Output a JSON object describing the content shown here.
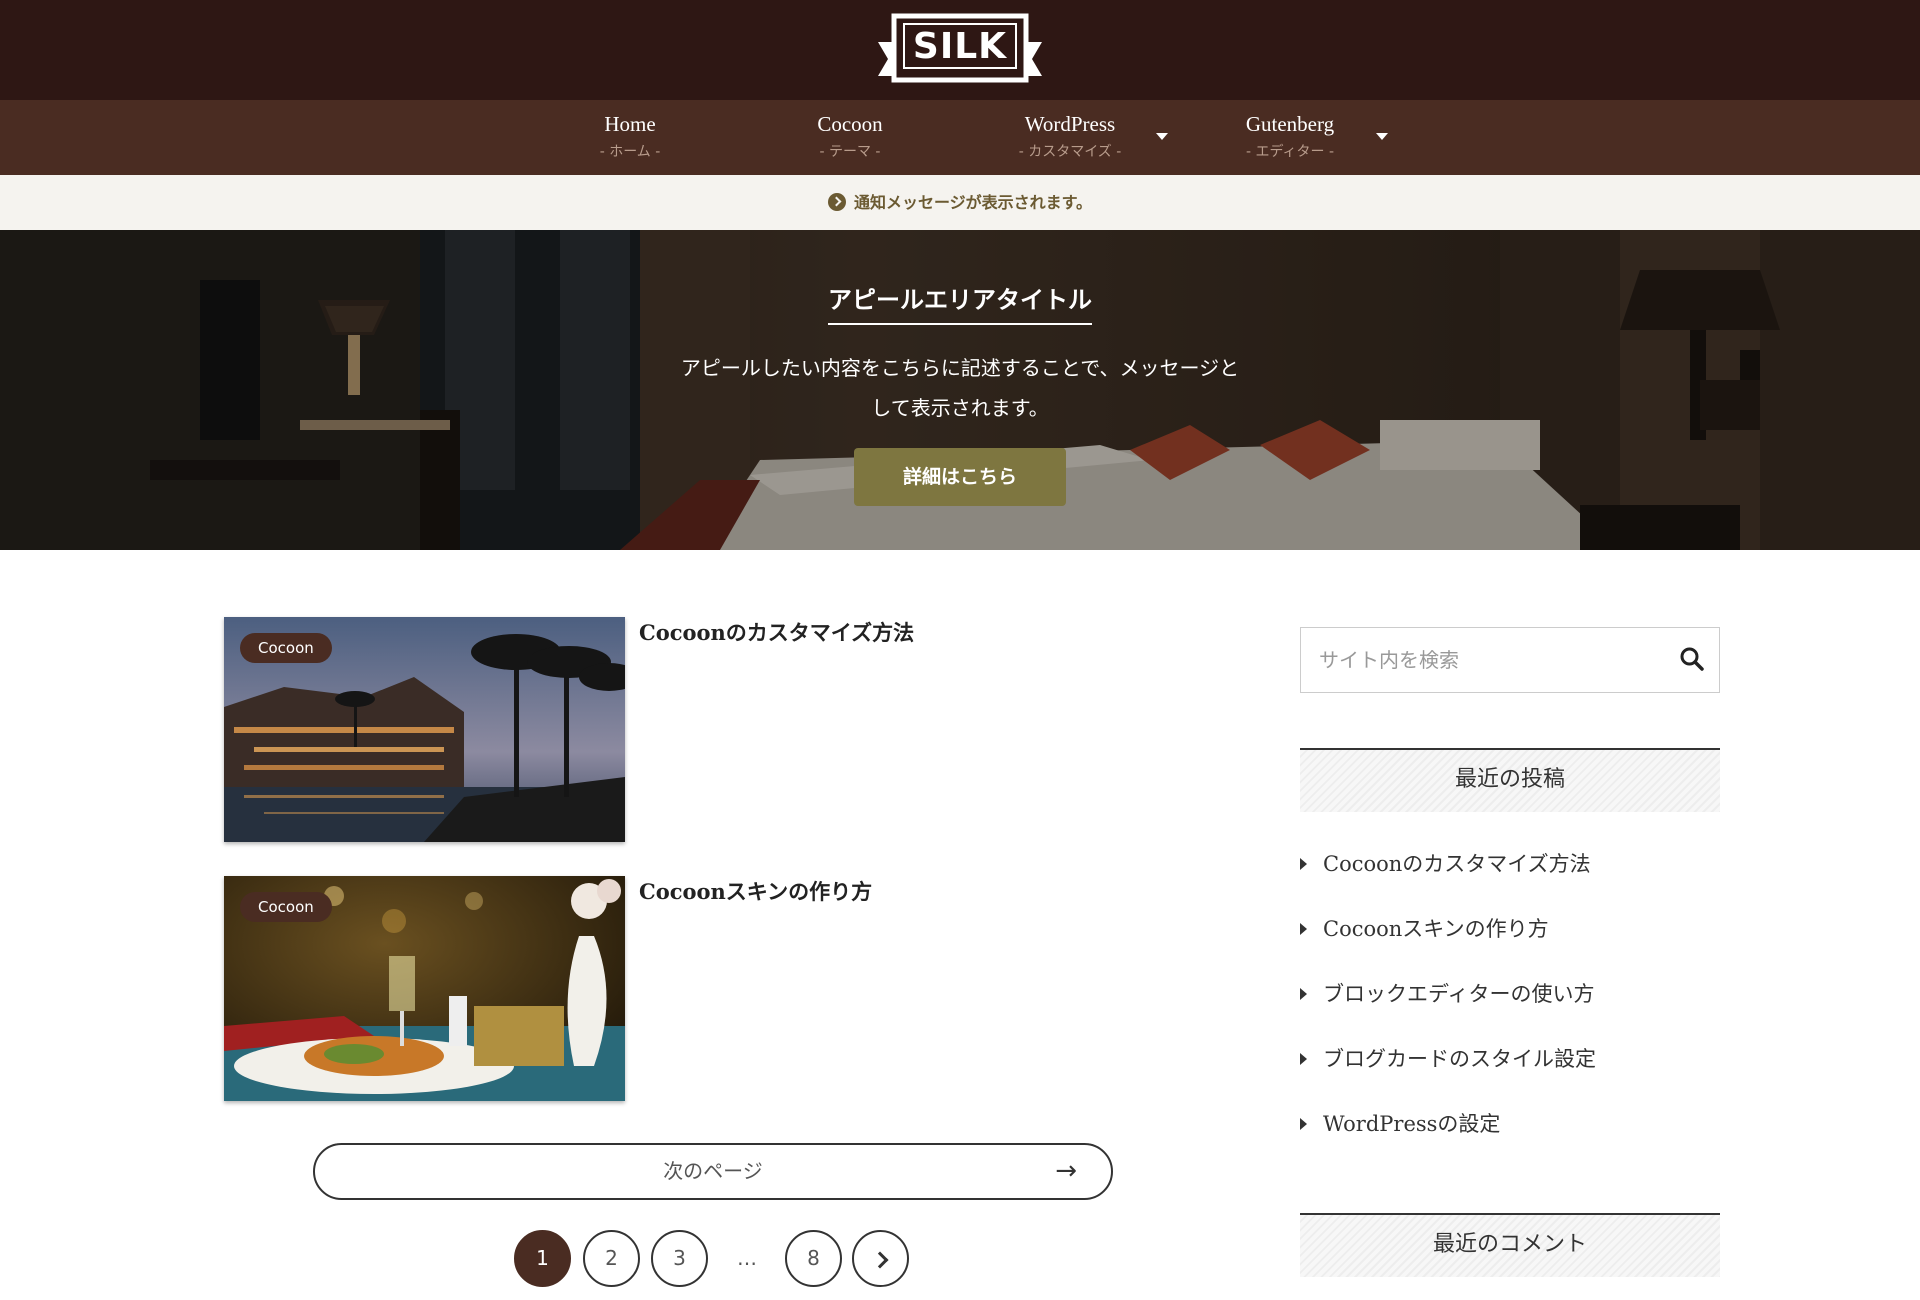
{
  "header": {
    "logo_text": "SILK"
  },
  "nav": {
    "items": [
      {
        "label": "Home",
        "sub": "- ホーム -"
      },
      {
        "label": "Cocoon",
        "sub": "- テーマ -"
      },
      {
        "label": "WordPress",
        "sub": "- カスタマイズ -"
      },
      {
        "label": "Gutenberg",
        "sub": "- エディター -"
      }
    ]
  },
  "notice": {
    "text": "通知メッセージが表示されます。"
  },
  "appeal": {
    "title": "アピールエリアタイトル",
    "message_line1": "アピールしたい内容をこちらに記述することで、メッセージと",
    "message_line2": "して表示されます。",
    "button_label": "詳細はこちら"
  },
  "posts": [
    {
      "category": "Cocoon",
      "title": "Cocoonのカスタマイズ方法"
    },
    {
      "category": "Cocoon",
      "title": "Cocoonスキンの作り方"
    }
  ],
  "next_page": {
    "label": "次のページ",
    "arrow": "→"
  },
  "pagination": {
    "pages": [
      "1",
      "2",
      "3"
    ],
    "dots": "…",
    "last": "8",
    "current": "1"
  },
  "sidebar": {
    "search_placeholder": "サイト内を検索",
    "recent_posts_title": "最近の投稿",
    "recent_posts": [
      "Cocoonのカスタマイズ方法",
      "Cocoonスキンの作り方",
      "ブロックエディターの使い方",
      "ブログカードのスタイル設定",
      "WordPressの設定"
    ],
    "recent_comments_title": "最近のコメント"
  },
  "colors": {
    "header_bg": "#2e1714",
    "nav_bg": "#4a2c22",
    "appeal_button": "#7e7640",
    "notice_text": "#6b5a32"
  }
}
